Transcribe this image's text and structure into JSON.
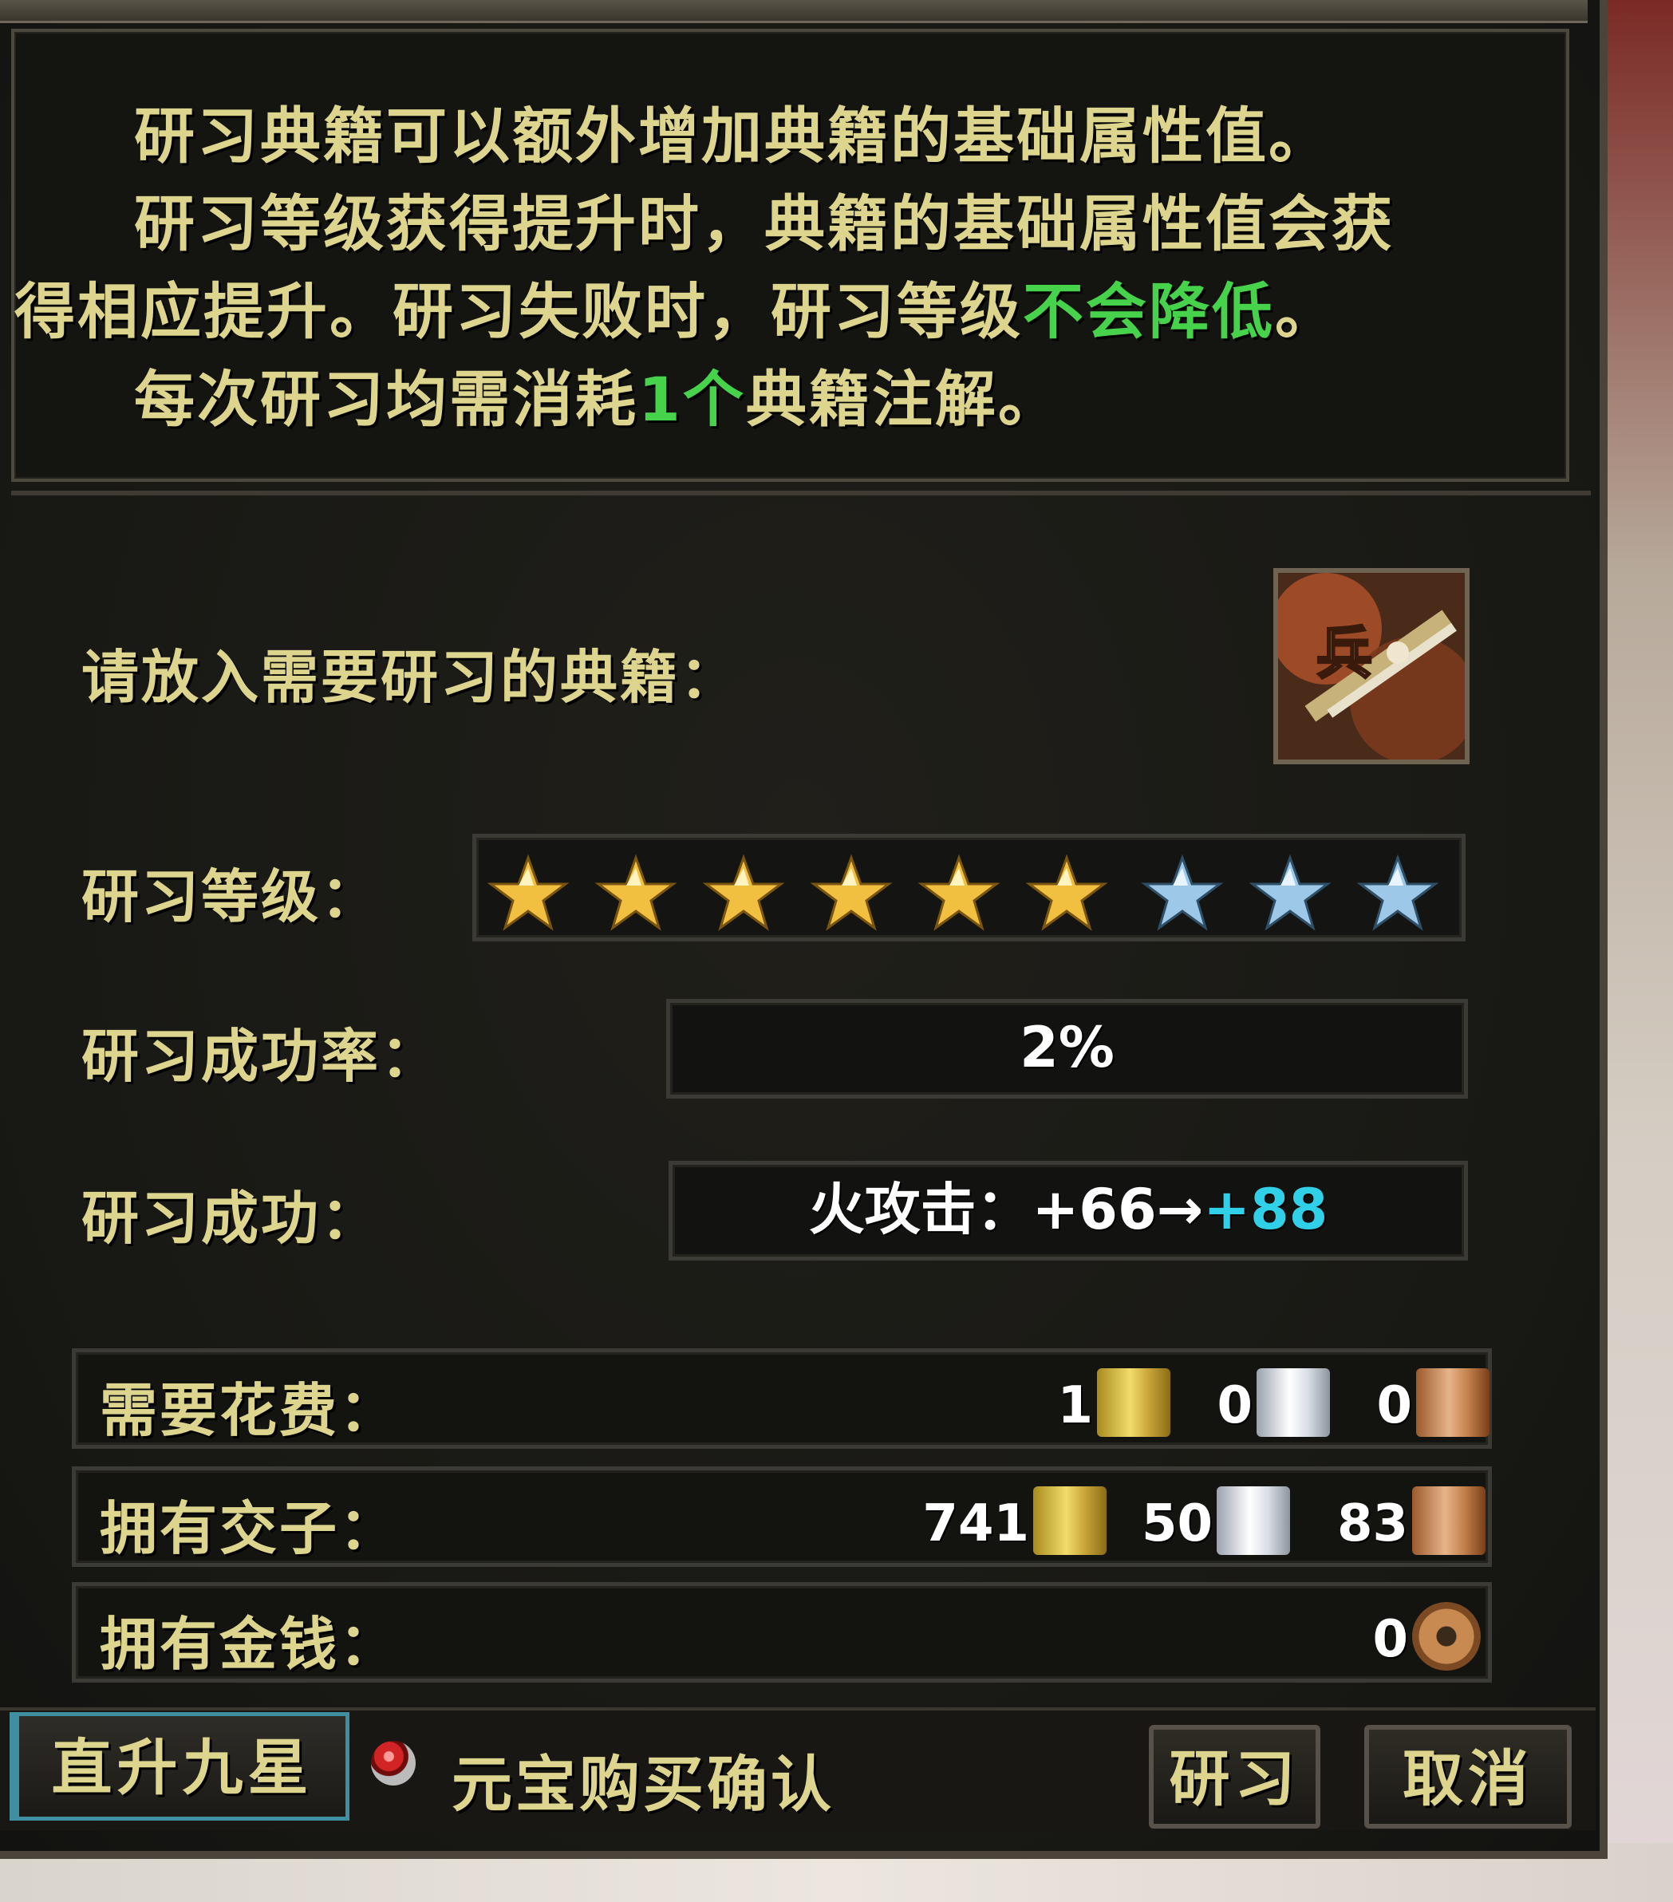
{
  "intro": {
    "line1": "研习典籍可以额外增加典籍的基础属性值。",
    "line2": "研习等级获得提升时，典籍的基础属性值会获",
    "line3_prefix": "得相应提升。研习失败时，研习等级",
    "line3_highlight": "不会降低",
    "line3_suffix": "。",
    "line4_prefix": "每次研习均需消耗",
    "line4_highlight": "1个",
    "line4_suffix": "典籍注解。"
  },
  "book_slot": {
    "label": "请放入需要研习的典籍：",
    "item_glyph": "兵",
    "icon": "weapon-book-icon"
  },
  "level": {
    "label": "研习等级：",
    "filled": 6,
    "total": 9,
    "filled_color": "#f1c040",
    "empty_color": "#9ec8e8"
  },
  "success_rate": {
    "label": "研习成功率：",
    "value": "2%"
  },
  "success_result": {
    "label": "研习成功：",
    "attr": "火攻击：",
    "from": "+66",
    "arrow": "→",
    "to": "+88"
  },
  "cost": {
    "label": "需要花费：",
    "gold": "1",
    "silver": "0",
    "bronze": "0"
  },
  "owned_tokens": {
    "label": "拥有交子：",
    "gold": "741",
    "silver": "50",
    "bronze": "83"
  },
  "owned_money": {
    "label": "拥有金钱：",
    "amount": "0"
  },
  "footer": {
    "nine_star_button": "直升九星",
    "confirm_label": "元宝购买确认",
    "study_button": "研习",
    "cancel_button": "取消"
  },
  "colors": {
    "label_text": "#ddd58e",
    "highlight_green": "#46d24a",
    "highlight_cyan": "#30d0e8"
  }
}
